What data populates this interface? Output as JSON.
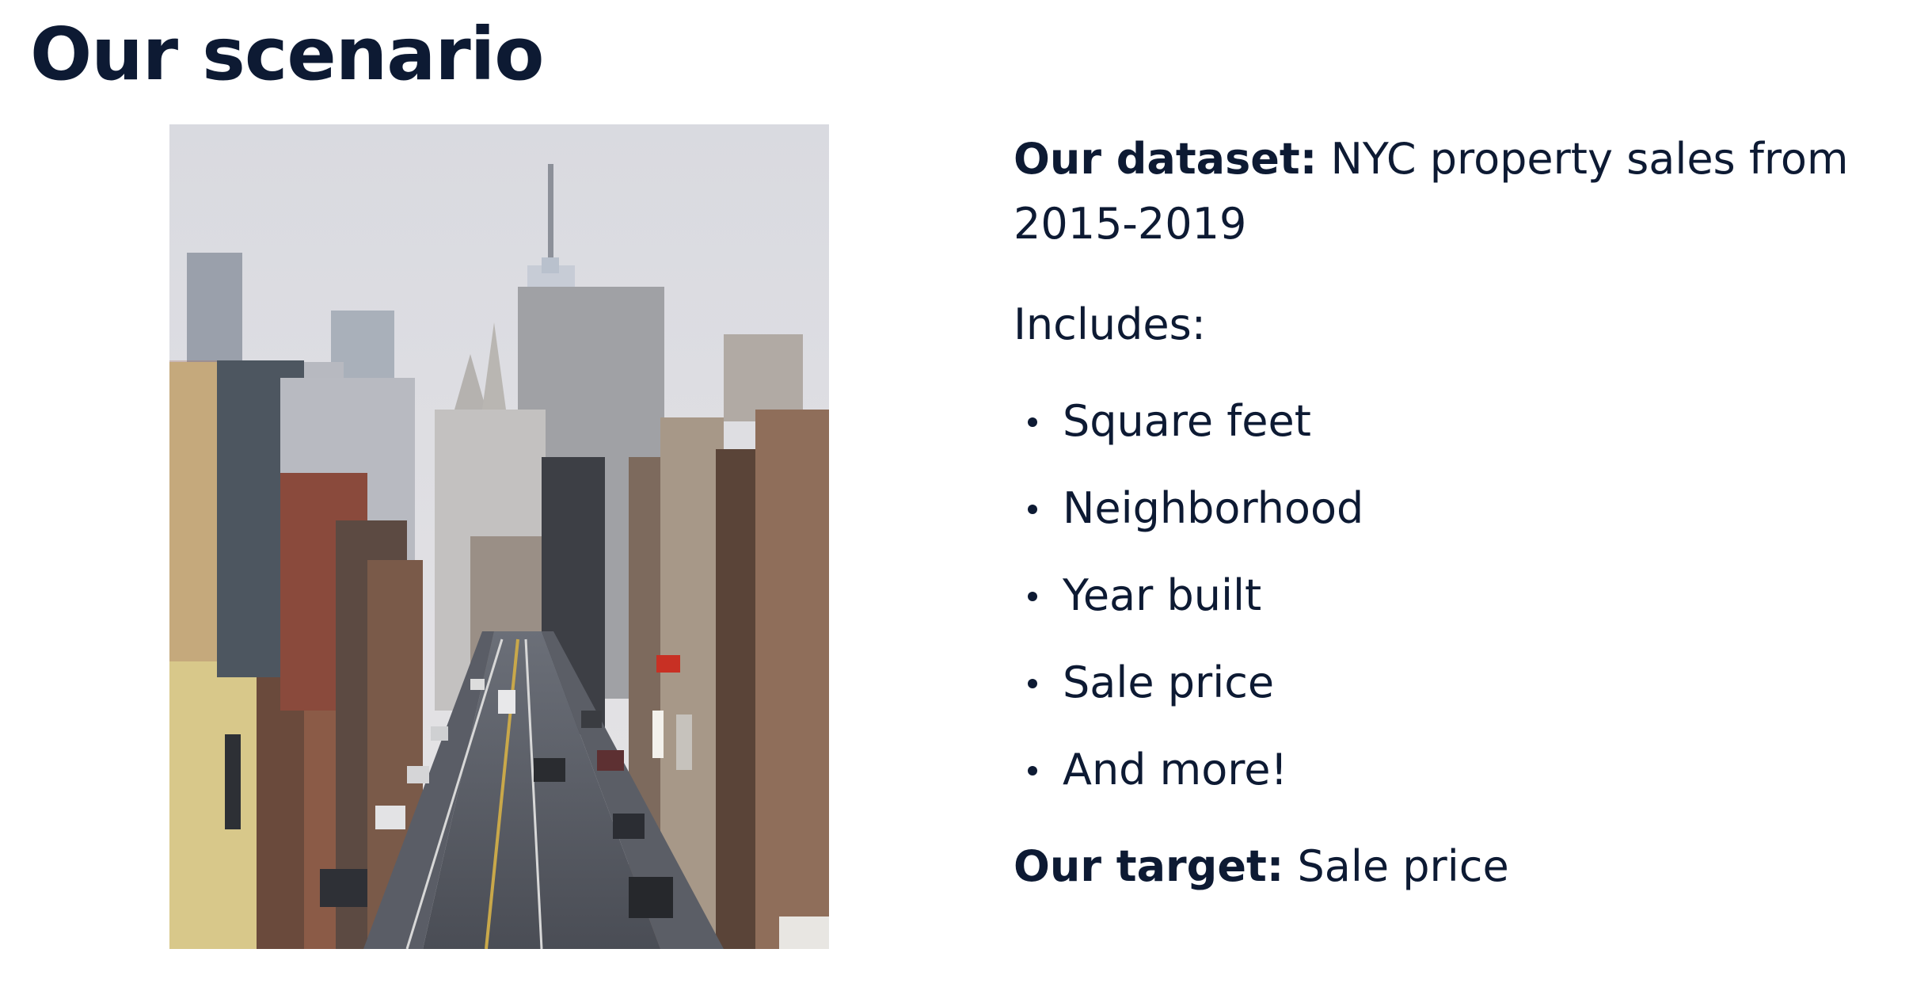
{
  "slide": {
    "title": "Our scenario",
    "dataset_label": "Our dataset:",
    "dataset_text": " NYC property sales from 2015-2019",
    "includes_label": "Includes:",
    "features": [
      "Square feet",
      "Neighborhood",
      "Year built",
      "Sale price",
      "And more!"
    ],
    "target_label": "Our target:",
    "target_text": " Sale price"
  },
  "colors": {
    "text": "#0d1a33",
    "background": "#ffffff"
  },
  "image": {
    "subject": "street-photo"
  }
}
